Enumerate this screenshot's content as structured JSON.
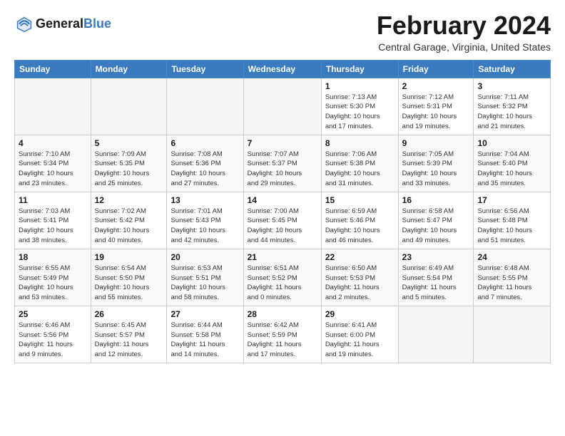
{
  "header": {
    "logo_line1": "General",
    "logo_line2": "Blue",
    "month_title": "February 2024",
    "location": "Central Garage, Virginia, United States"
  },
  "weekdays": [
    "Sunday",
    "Monday",
    "Tuesday",
    "Wednesday",
    "Thursday",
    "Friday",
    "Saturday"
  ],
  "weeks": [
    [
      {
        "day": "",
        "info": ""
      },
      {
        "day": "",
        "info": ""
      },
      {
        "day": "",
        "info": ""
      },
      {
        "day": "",
        "info": ""
      },
      {
        "day": "1",
        "info": "Sunrise: 7:13 AM\nSunset: 5:30 PM\nDaylight: 10 hours\nand 17 minutes."
      },
      {
        "day": "2",
        "info": "Sunrise: 7:12 AM\nSunset: 5:31 PM\nDaylight: 10 hours\nand 19 minutes."
      },
      {
        "day": "3",
        "info": "Sunrise: 7:11 AM\nSunset: 5:32 PM\nDaylight: 10 hours\nand 21 minutes."
      }
    ],
    [
      {
        "day": "4",
        "info": "Sunrise: 7:10 AM\nSunset: 5:34 PM\nDaylight: 10 hours\nand 23 minutes."
      },
      {
        "day": "5",
        "info": "Sunrise: 7:09 AM\nSunset: 5:35 PM\nDaylight: 10 hours\nand 25 minutes."
      },
      {
        "day": "6",
        "info": "Sunrise: 7:08 AM\nSunset: 5:36 PM\nDaylight: 10 hours\nand 27 minutes."
      },
      {
        "day": "7",
        "info": "Sunrise: 7:07 AM\nSunset: 5:37 PM\nDaylight: 10 hours\nand 29 minutes."
      },
      {
        "day": "8",
        "info": "Sunrise: 7:06 AM\nSunset: 5:38 PM\nDaylight: 10 hours\nand 31 minutes."
      },
      {
        "day": "9",
        "info": "Sunrise: 7:05 AM\nSunset: 5:39 PM\nDaylight: 10 hours\nand 33 minutes."
      },
      {
        "day": "10",
        "info": "Sunrise: 7:04 AM\nSunset: 5:40 PM\nDaylight: 10 hours\nand 35 minutes."
      }
    ],
    [
      {
        "day": "11",
        "info": "Sunrise: 7:03 AM\nSunset: 5:41 PM\nDaylight: 10 hours\nand 38 minutes."
      },
      {
        "day": "12",
        "info": "Sunrise: 7:02 AM\nSunset: 5:42 PM\nDaylight: 10 hours\nand 40 minutes."
      },
      {
        "day": "13",
        "info": "Sunrise: 7:01 AM\nSunset: 5:43 PM\nDaylight: 10 hours\nand 42 minutes."
      },
      {
        "day": "14",
        "info": "Sunrise: 7:00 AM\nSunset: 5:45 PM\nDaylight: 10 hours\nand 44 minutes."
      },
      {
        "day": "15",
        "info": "Sunrise: 6:59 AM\nSunset: 5:46 PM\nDaylight: 10 hours\nand 46 minutes."
      },
      {
        "day": "16",
        "info": "Sunrise: 6:58 AM\nSunset: 5:47 PM\nDaylight: 10 hours\nand 49 minutes."
      },
      {
        "day": "17",
        "info": "Sunrise: 6:56 AM\nSunset: 5:48 PM\nDaylight: 10 hours\nand 51 minutes."
      }
    ],
    [
      {
        "day": "18",
        "info": "Sunrise: 6:55 AM\nSunset: 5:49 PM\nDaylight: 10 hours\nand 53 minutes."
      },
      {
        "day": "19",
        "info": "Sunrise: 6:54 AM\nSunset: 5:50 PM\nDaylight: 10 hours\nand 55 minutes."
      },
      {
        "day": "20",
        "info": "Sunrise: 6:53 AM\nSunset: 5:51 PM\nDaylight: 10 hours\nand 58 minutes."
      },
      {
        "day": "21",
        "info": "Sunrise: 6:51 AM\nSunset: 5:52 PM\nDaylight: 11 hours\nand 0 minutes."
      },
      {
        "day": "22",
        "info": "Sunrise: 6:50 AM\nSunset: 5:53 PM\nDaylight: 11 hours\nand 2 minutes."
      },
      {
        "day": "23",
        "info": "Sunrise: 6:49 AM\nSunset: 5:54 PM\nDaylight: 11 hours\nand 5 minutes."
      },
      {
        "day": "24",
        "info": "Sunrise: 6:48 AM\nSunset: 5:55 PM\nDaylight: 11 hours\nand 7 minutes."
      }
    ],
    [
      {
        "day": "25",
        "info": "Sunrise: 6:46 AM\nSunset: 5:56 PM\nDaylight: 11 hours\nand 9 minutes."
      },
      {
        "day": "26",
        "info": "Sunrise: 6:45 AM\nSunset: 5:57 PM\nDaylight: 11 hours\nand 12 minutes."
      },
      {
        "day": "27",
        "info": "Sunrise: 6:44 AM\nSunset: 5:58 PM\nDaylight: 11 hours\nand 14 minutes."
      },
      {
        "day": "28",
        "info": "Sunrise: 6:42 AM\nSunset: 5:59 PM\nDaylight: 11 hours\nand 17 minutes."
      },
      {
        "day": "29",
        "info": "Sunrise: 6:41 AM\nSunset: 6:00 PM\nDaylight: 11 hours\nand 19 minutes."
      },
      {
        "day": "",
        "info": ""
      },
      {
        "day": "",
        "info": ""
      }
    ]
  ]
}
